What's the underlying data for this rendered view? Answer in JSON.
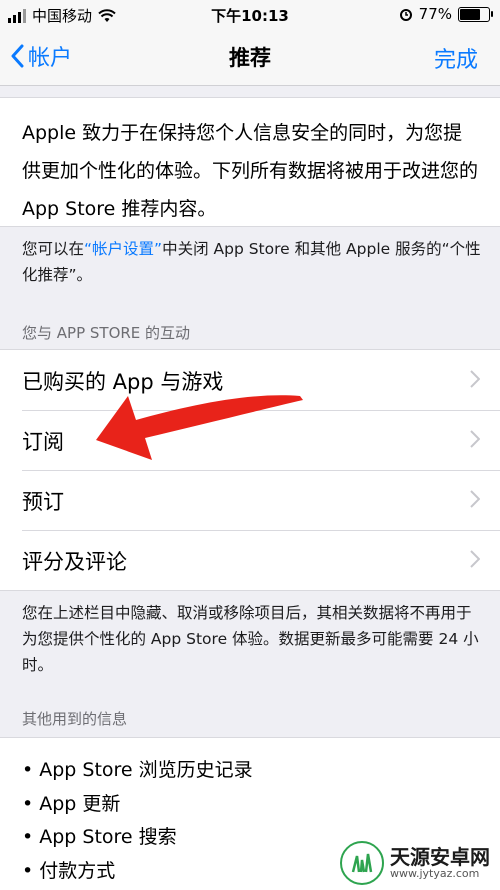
{
  "status_bar": {
    "carrier": "中国移动",
    "time": "下午10:13",
    "battery": "77%",
    "battery_level": 0.77
  },
  "nav": {
    "back_label": "帐户",
    "title": "推荐",
    "done_label": "完成"
  },
  "intro_text": "Apple 致力于在保持您个人信息安全的同时，为您提供更加个性化的体验。下列所有数据将被用于改进您的 App Store 推荐内容。",
  "note1": {
    "prefix": "您可以在",
    "link": "“帐户设置”",
    "suffix": "中关闭 App Store 和其他 Apple 服务的“个性化推荐”。"
  },
  "section1_header": "您与 APP STORE 的互动",
  "interaction_items": [
    {
      "label": "已购买的 App 与游戏"
    },
    {
      "label": "订阅"
    },
    {
      "label": "预订"
    },
    {
      "label": "评分及评论"
    }
  ],
  "note2": "您在上述栏目中隐藏、取消或移除项目后，其相关数据将不再用于为您提供个性化的 App Store 体验。数据更新最多可能需要 24 小时。",
  "section2_header": "其他用到的信息",
  "other_info": [
    "App Store 浏览历史记录",
    "App 更新",
    "App Store 搜索",
    "付款方式"
  ],
  "watermark": {
    "name": "天源安卓网",
    "url": "www.jytyaz.com"
  },
  "colors": {
    "accent": "#0a7aff",
    "annotation_arrow": "#e8231a"
  }
}
